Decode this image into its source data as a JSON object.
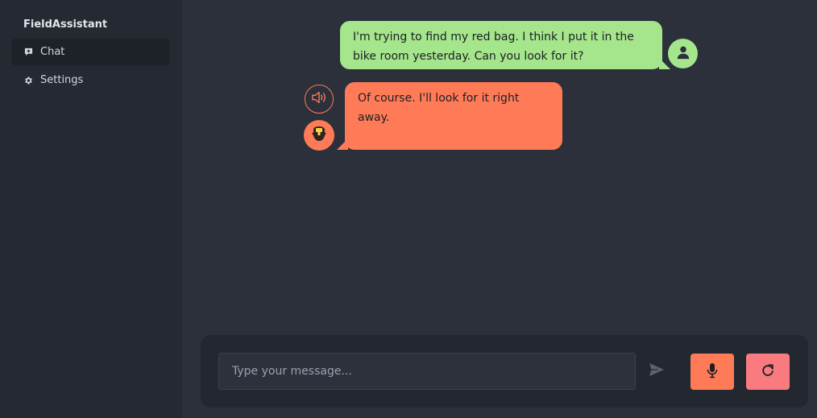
{
  "app": {
    "name": "FieldAssistant"
  },
  "sidebar": {
    "items": [
      {
        "label": "Chat",
        "icon": "chat-icon",
        "active": true
      },
      {
        "label": "Settings",
        "icon": "gear-icon",
        "active": false
      }
    ]
  },
  "chat": {
    "messages": [
      {
        "role": "user",
        "text": "I'm trying to find my red bag. I think I put it in the bike room yesterday. Can you look for it?"
      },
      {
        "role": "assistant",
        "text": "Of course. I'll look for it right away."
      }
    ]
  },
  "composer": {
    "placeholder": "Type your message...",
    "value": ""
  },
  "colors": {
    "background": "#2b303a",
    "sidebar": "#242932",
    "user_bubble": "#a5e58b",
    "assistant_bubble": "#ff7b58",
    "reset_button": "#f97b80"
  },
  "icons": {
    "user_avatar": "user-icon",
    "assistant_avatar": "robot-icon",
    "speaker": "speaker-icon",
    "send": "send-icon",
    "mic": "microphone-icon",
    "reset": "refresh-icon"
  }
}
